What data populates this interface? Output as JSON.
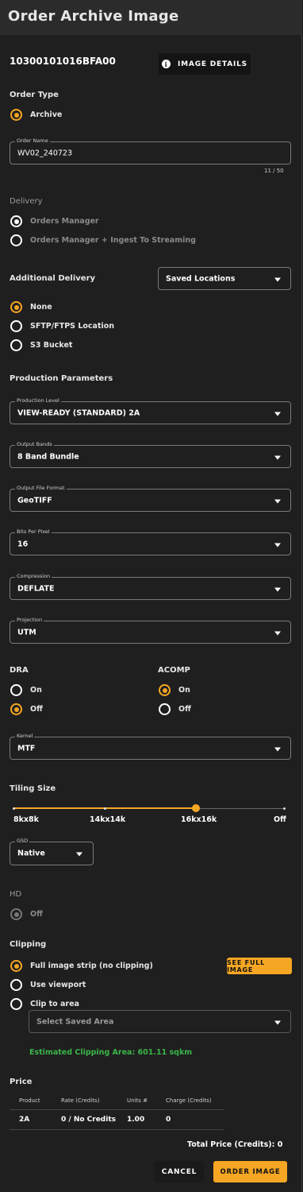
{
  "header": {
    "title": "Order Archive Image"
  },
  "image": {
    "id": "10300101016BFA00",
    "details_button": "IMAGE DETAILS"
  },
  "order_type": {
    "label": "Order Type",
    "options": [
      "Archive"
    ]
  },
  "order_name": {
    "label": "Order Name",
    "value": "WV02_240723",
    "counter": "11 / 50"
  },
  "delivery": {
    "label": "Delivery",
    "options": [
      "Orders Manager",
      "Orders Manager + Ingest To Streaming"
    ]
  },
  "additional_delivery": {
    "label": "Additional Delivery",
    "saved_locations": "Saved Locations",
    "options": [
      "None",
      "SFTP/FTPS Location",
      "S3 Bucket"
    ]
  },
  "production": {
    "label": "Production Parameters",
    "fields": [
      {
        "label": "Production Level",
        "value": "VIEW-READY (STANDARD) 2A"
      },
      {
        "label": "Output Bands",
        "value": "8 Band Bundle"
      },
      {
        "label": "Output File Format",
        "value": "GeoTIFF"
      },
      {
        "label": "Bits Per Pixel",
        "value": "16"
      },
      {
        "label": "Compression",
        "value": "DEFLATE"
      },
      {
        "label": "Projection",
        "value": "UTM"
      }
    ]
  },
  "dra": {
    "label": "DRA",
    "on": "On",
    "off": "Off",
    "selected": "Off"
  },
  "acomp": {
    "label": "ACOMP",
    "on": "On",
    "off": "Off",
    "selected": "On"
  },
  "kernel": {
    "label": "Kernel",
    "value": "MTF"
  },
  "tiling": {
    "label": "Tiling Size",
    "ticks": [
      "8kx8k",
      "14kx14k",
      "16kx16k",
      "Off"
    ],
    "selected": "16kx16k"
  },
  "gsd": {
    "label": "GSD",
    "value": "Native"
  },
  "hd": {
    "label": "HD",
    "option": "Off"
  },
  "clipping": {
    "label": "Clipping",
    "options": [
      "Full image strip (no clipping)",
      "Use viewport",
      "Clip to area"
    ],
    "see_full_image": "SEE FULL IMAGE",
    "saved_area_placeholder": "Select Saved Area",
    "estimated": "Estimated Clipping Area: 601.11 sqkm"
  },
  "price": {
    "label": "Price",
    "headers": [
      "Product",
      "Rate (Credits)",
      "Units #",
      "Charge (Credits)"
    ],
    "rows": [
      [
        "2A",
        "0 / No Credits",
        "1.00",
        "0"
      ]
    ],
    "total": "Total Price (Credits): 0"
  },
  "actions": {
    "cancel": "CANCEL",
    "order": "ORDER IMAGE"
  },
  "colors": {
    "accent": "#f5a623",
    "success": "#3bb54a",
    "background": "#1f1f1f"
  }
}
